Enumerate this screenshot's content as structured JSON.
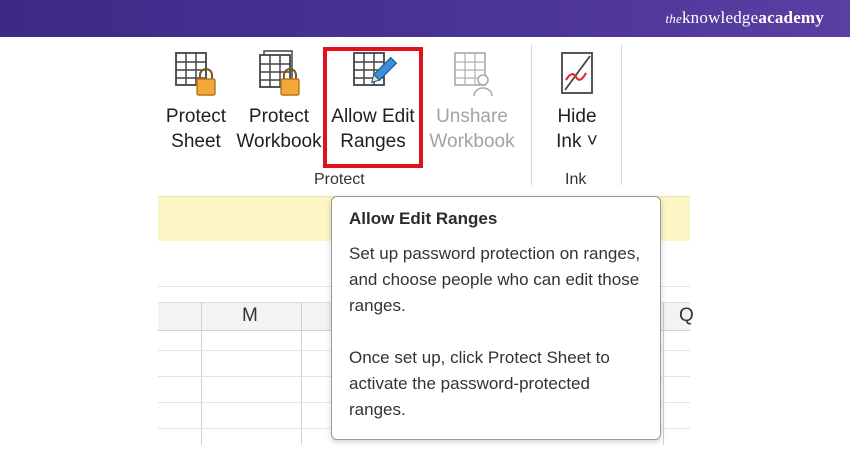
{
  "brand": {
    "the": "the",
    "knowledge": "knowledge",
    "academy": "academy"
  },
  "ribbon": {
    "protect_sheet": [
      "Protect",
      "Sheet"
    ],
    "protect_workbook": [
      "Protect",
      "Workbook"
    ],
    "allow_edit_ranges": [
      "Allow Edit",
      "Ranges"
    ],
    "unshare_workbook": [
      "Unshare",
      "Workbook"
    ],
    "hide_ink": [
      "Hide",
      "Ink ˅"
    ],
    "group_protect": "Protect",
    "group_ink": "Ink"
  },
  "sheet": {
    "col_m": "M",
    "col_q": "Q"
  },
  "tooltip": {
    "title": "Allow Edit Ranges",
    "p1": "Set up password protection on ranges, and choose people who can edit those ranges.",
    "p2": "Once set up, click Protect Sheet to activate the password-protected ranges."
  },
  "colors": {
    "header": "#4b3597",
    "highlight": "#e2101b",
    "lock": "#f2a83a",
    "pencil": "#3a8fd6",
    "ink": "#e22b2b"
  }
}
